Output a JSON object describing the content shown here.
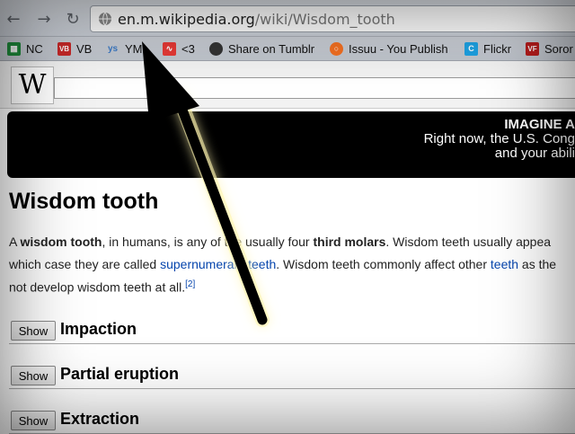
{
  "browser": {
    "url_host": "en.m.wikipedia.org",
    "url_path": "/wiki/Wisdom_tooth"
  },
  "bookmarks": [
    {
      "label": "NC",
      "icon": "spreadsheet-icon",
      "color": "#1e8a3a"
    },
    {
      "label": "VB",
      "icon": "vb-icon",
      "color": "#c62828"
    },
    {
      "label": "YM",
      "icon": "ys-icon",
      "color": "#3a78c2"
    },
    {
      "label": "<3",
      "icon": "heartbeat-icon",
      "color": "#e53935"
    },
    {
      "label": "Share on Tumblr",
      "icon": "tumblr-icon",
      "color": "#333333"
    },
    {
      "label": "Issuu - You Publish",
      "icon": "issuu-icon",
      "color": "#f26f21"
    },
    {
      "label": "Flickr",
      "icon": "c-icon",
      "color": "#1da1e2"
    },
    {
      "label": "Soror",
      "icon": "vf-icon",
      "color": "#b71c1c"
    }
  ],
  "wiki": {
    "logo": "W"
  },
  "banner": {
    "line1": "IMAGINE A",
    "line2": "Right now, the U.S. Cong",
    "line3": "and your abili"
  },
  "article": {
    "title": "Wisdom tooth",
    "p1_a": "A ",
    "p1_b": "wisdom tooth",
    "p1_c": ", in humans, is any of the usually four ",
    "p1_d": "third molars",
    "p1_e": ". Wisdom teeth usually appea",
    "p2_a": "which case they are called ",
    "p2_link1": "supernumerary teeth",
    "p2_b": ". Wisdom teeth commonly affect other ",
    "p2_link2": "teeth",
    "p2_c": " as the",
    "p3_a": "not develop wisdom teeth at all.",
    "p3_ref": "[2]"
  },
  "sections": [
    {
      "button": "Show",
      "title": "Impaction"
    },
    {
      "button": "Show",
      "title": "Partial eruption"
    },
    {
      "button": "Show",
      "title": "Extraction"
    }
  ]
}
